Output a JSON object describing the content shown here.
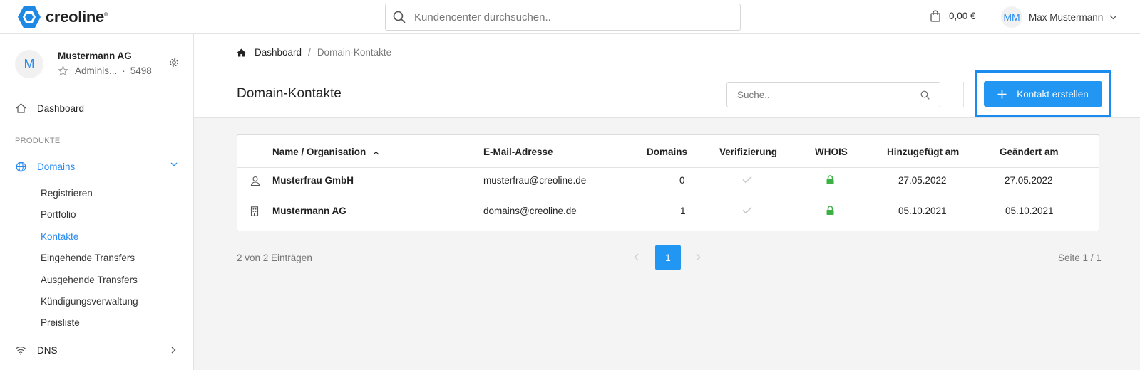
{
  "brand": {
    "name": "creoline",
    "mark": "®"
  },
  "topbar": {
    "search_placeholder": "Kundencenter durchsuchen..",
    "cart_amount": "0,00 €",
    "user_initials": "MM",
    "user_name": "Max Mustermann"
  },
  "account": {
    "initial": "M",
    "name": "Mustermann AG",
    "role": "Adminis...",
    "separator": "·",
    "number": "5498"
  },
  "sidebar": {
    "dashboard": "Dashboard",
    "section_products": "PRODUKTE",
    "domains": "Domains",
    "sub_items": [
      "Registrieren",
      "Portfolio",
      "Kontakte",
      "Eingehende Transfers",
      "Ausgehende Transfers",
      "Kündigungsverwaltung",
      "Preisliste"
    ],
    "dns": "DNS"
  },
  "breadcrumb": {
    "home": "Dashboard",
    "separator": "/",
    "current": "Domain-Kontakte"
  },
  "page": {
    "title": "Domain-Kontakte",
    "search_placeholder": "Suche..",
    "create_button": "Kontakt erstellen"
  },
  "table": {
    "columns": [
      "Name / Organisation",
      "E-Mail-Adresse",
      "Domains",
      "Verifizierung",
      "WHOIS",
      "Hinzugefügt am",
      "Geändert am"
    ],
    "rows": [
      {
        "type_icon": "person-icon",
        "name": "Musterfrau GmbH",
        "email": "musterfrau@creoline.de",
        "domains": "0",
        "verified": "check-icon",
        "whois": "lock-icon",
        "added": "27.05.2022",
        "changed": "27.05.2022"
      },
      {
        "type_icon": "building-icon",
        "name": "Mustermann AG",
        "email": "domains@creoline.de",
        "domains": "1",
        "verified": "check-icon",
        "whois": "lock-icon",
        "added": "05.10.2021",
        "changed": "05.10.2021"
      }
    ]
  },
  "pagination": {
    "count_text": "2 von 2 Einträgen",
    "current_page": "1",
    "page_info": "Seite 1 / 1"
  },
  "colors": {
    "accent": "#2196f3",
    "lock": "#3cb043",
    "focus_frame": "#1a8cf0"
  }
}
